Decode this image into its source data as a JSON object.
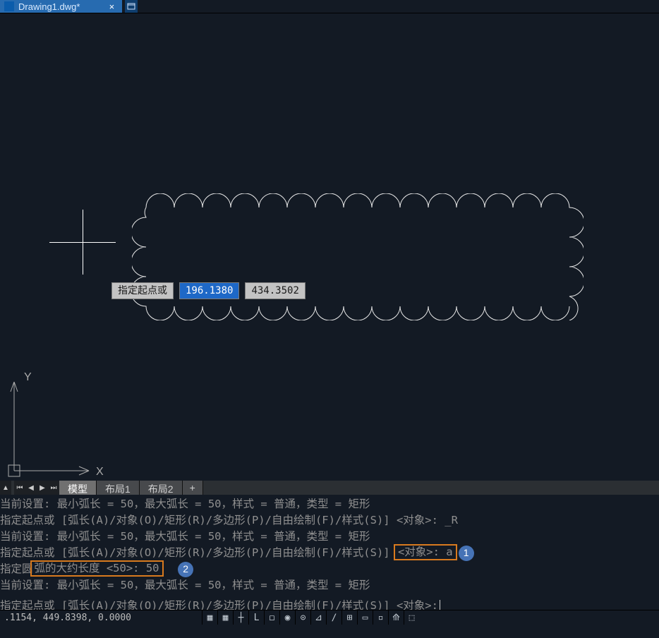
{
  "filetab": {
    "name": "Drawing1.dwg*",
    "close": "×",
    "new_icon": "▢"
  },
  "dyninput": {
    "prompt": "指定起点或",
    "val1": "196.1380",
    "val2": "434.3502"
  },
  "ucs": {
    "x_label": "X",
    "y_label": "Y"
  },
  "layouttabs": {
    "nav_first": "⏮",
    "nav_prev": "◀",
    "nav_next": "▶",
    "nav_last": "⏭",
    "up": "▲",
    "model": "模型",
    "layout1": "布局1",
    "layout2": "布局2",
    "plus": "+"
  },
  "cmd": {
    "l1": "当前设置: 最小弧长 = 50，最大弧长 = 50，样式 = 普通，类型 = 矩形",
    "l2": "指定起点或 [弧长(A)/对象(O)/矩形(R)/多边形(P)/自由绘制(F)/样式(S)] <对象>: _R",
    "l3": "当前设置: 最小弧长 = 50，最大弧长 = 50，样式 = 普通，类型 = 矩形",
    "l4a": "指定起点或 [弧长(A)/对象(O)/矩形(R)/多边形(P)/自由绘制(F)/样式(S)] ",
    "l4b": "<对象>: a",
    "l5a": "指定圆",
    "l5b": "弧的大约长度 <50>: 50",
    "l6": "当前设置: 最小弧长 = 50，最大弧长 = 50，样式 = 普通，类型 = 矩形",
    "prompt": "指定起点或 [弧长(A)/对象(O)/矩形(R)/多边形(P)/自由绘制(F)/样式(S)] <对象>: "
  },
  "badge1": "1",
  "badge2": "2",
  "status": {
    "coords": ".1154, 449.8398, 0.0000"
  },
  "status_icons": {
    "i1": "▦",
    "i2": "▦",
    "i3": "┼",
    "i4": "L",
    "i5": "◻",
    "i6": "◉",
    "i7": "⊙",
    "i8": "⊿",
    "i9": "∕",
    "i10": "⊞",
    "i11": "▭",
    "i12": "▫",
    "i13": "⟰",
    "i14": "⬚"
  }
}
